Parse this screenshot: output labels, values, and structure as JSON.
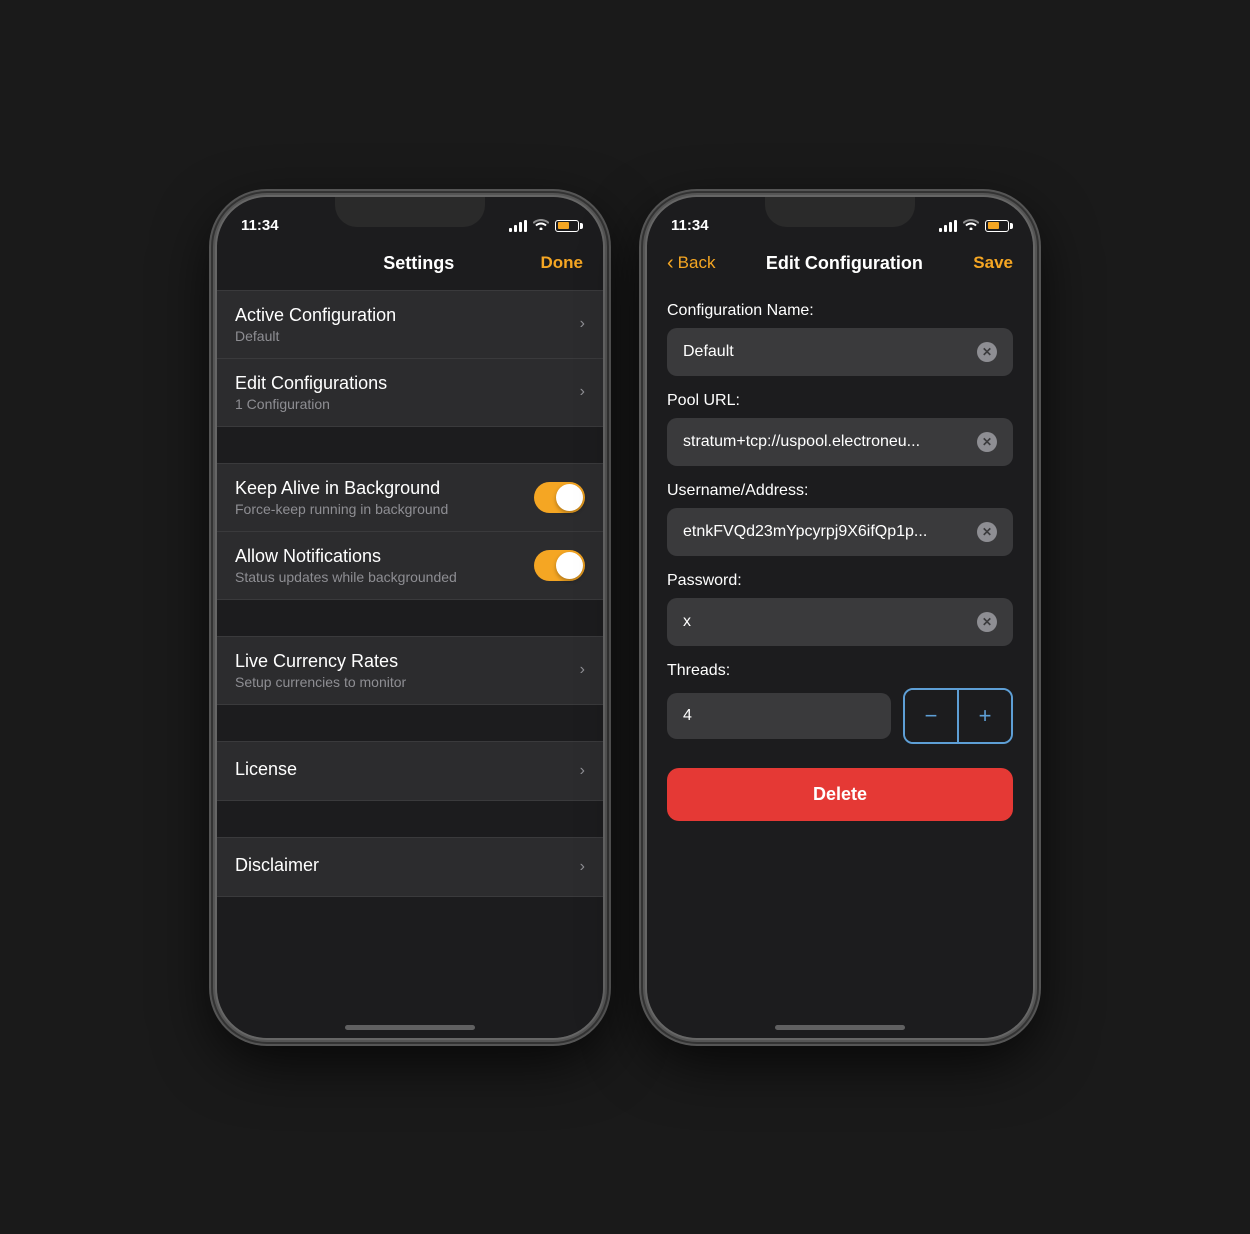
{
  "phone1": {
    "status": {
      "time": "11:34",
      "signal": "full",
      "wifi": "on",
      "battery": "charging"
    },
    "nav": {
      "title": "Settings",
      "action": "Done"
    },
    "items": [
      {
        "title": "Active Configuration",
        "subtitle": "Default",
        "type": "chevron"
      },
      {
        "title": "Edit Configurations",
        "subtitle": "1 Configuration",
        "type": "chevron"
      },
      {
        "title": "Keep Alive in Background",
        "subtitle": "Force-keep running in background",
        "type": "toggle",
        "toggled": true
      },
      {
        "title": "Allow Notifications",
        "subtitle": "Status updates while backgrounded",
        "type": "toggle",
        "toggled": true
      },
      {
        "title": "Live Currency Rates",
        "subtitle": "Setup currencies to monitor",
        "type": "chevron"
      },
      {
        "title": "License",
        "subtitle": "",
        "type": "chevron"
      },
      {
        "title": "Disclaimer",
        "subtitle": "",
        "type": "chevron"
      }
    ]
  },
  "phone2": {
    "status": {
      "time": "11:34"
    },
    "nav": {
      "back": "Back",
      "title": "Edit Configuration",
      "action": "Save"
    },
    "fields": {
      "config_name_label": "Configuration Name:",
      "config_name_value": "Default",
      "pool_url_label": "Pool URL:",
      "pool_url_value": "stratum+tcp://uspool.electroneu...",
      "username_label": "Username/Address:",
      "username_value": "etnkFVQd23mYpcyrpj9X6ifQp1p...",
      "password_label": "Password:",
      "password_value": "x",
      "threads_label": "Threads:",
      "threads_value": "4"
    },
    "buttons": {
      "decrement": "−",
      "increment": "+",
      "delete": "Delete"
    }
  }
}
